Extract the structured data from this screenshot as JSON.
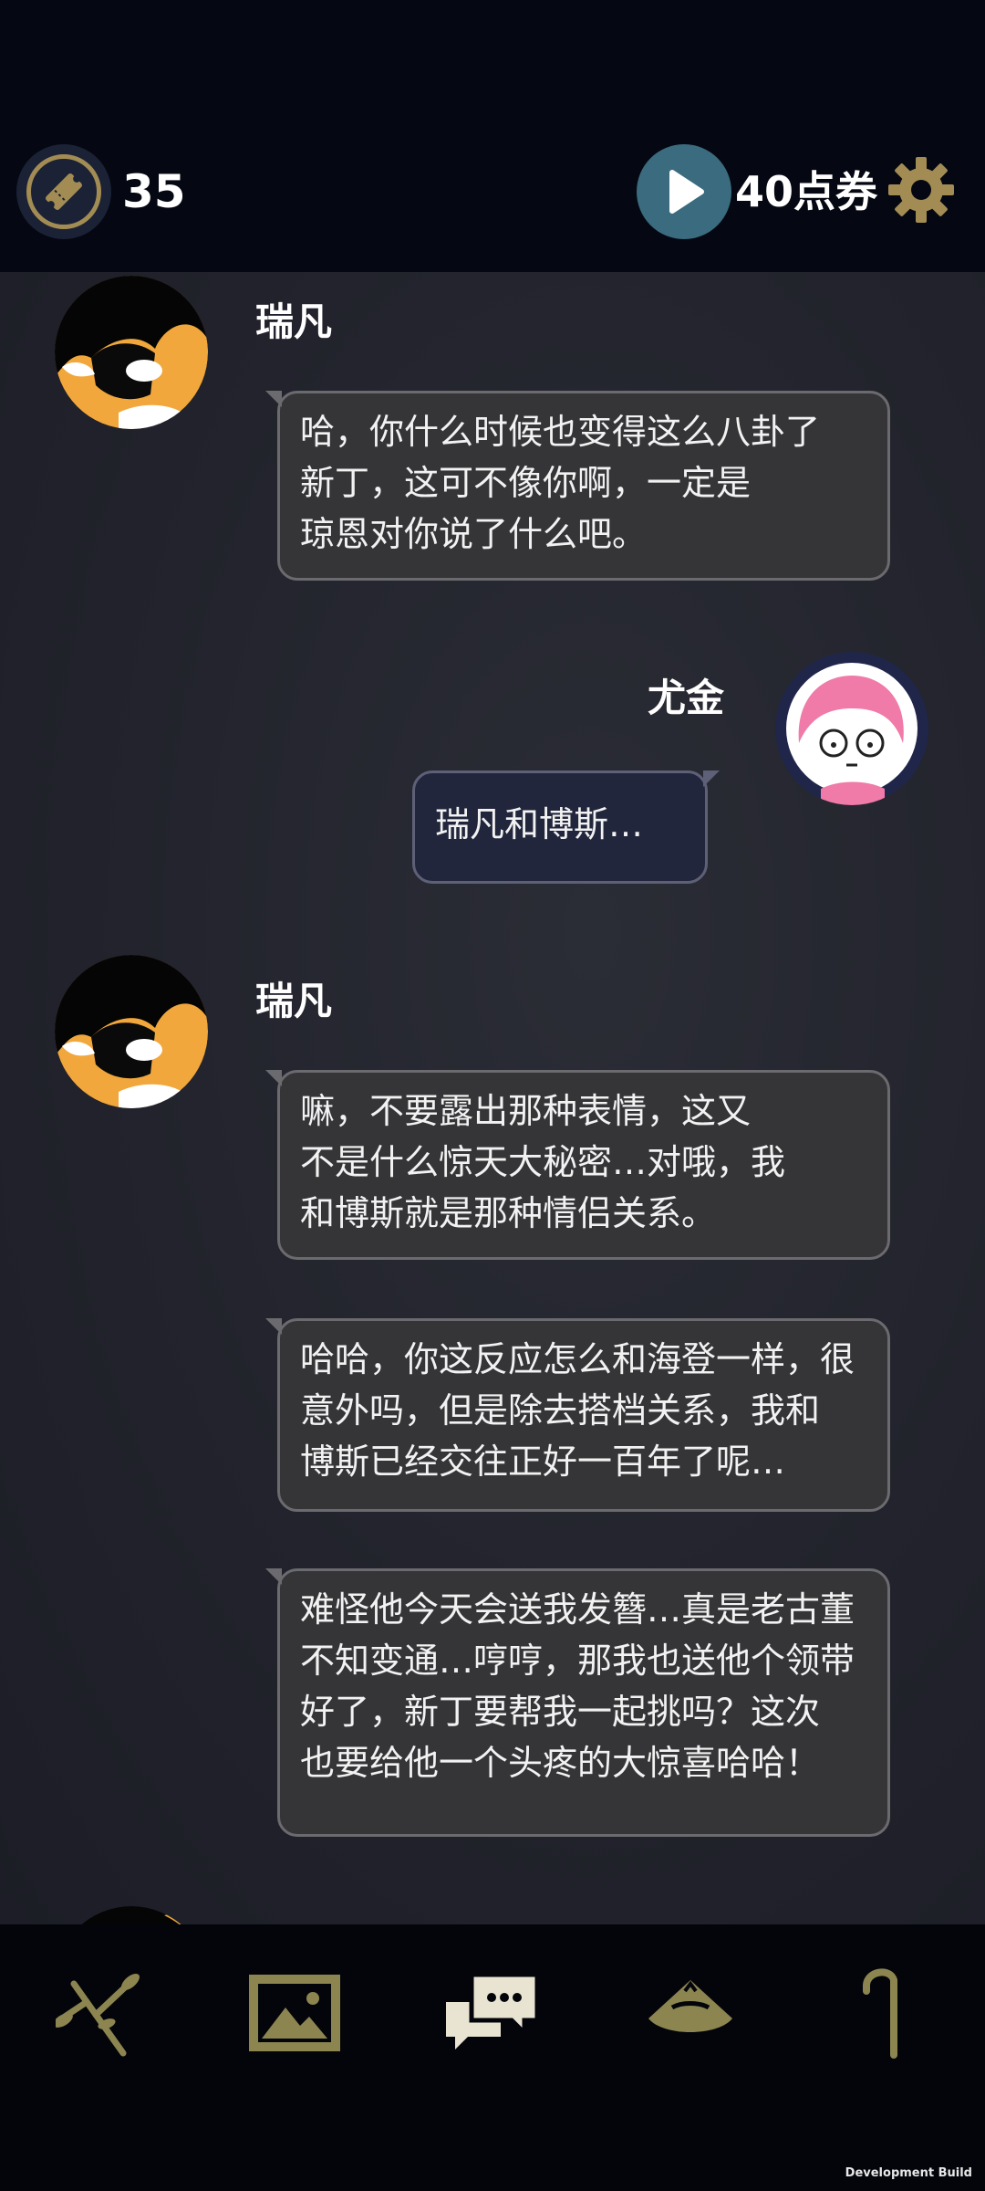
{
  "header": {
    "ticket_count": "35",
    "points_label": "40点券",
    "accent_color": "#a38c54",
    "play_color": "#3a6b7e"
  },
  "messages": [
    {
      "side": "left",
      "sender": "瑞凡",
      "lines": [
        "哈，你什么时候也变得这么八卦了",
        "新丁，这可不像你啊，一定是",
        "琼恩对你说了什么吧。"
      ]
    },
    {
      "side": "right",
      "sender": "尤金",
      "lines": [
        "瑞凡和博斯…"
      ]
    },
    {
      "side": "left",
      "sender": "瑞凡",
      "lines": [
        "嘛，不要露出那种表情，这又",
        "不是什么惊天大秘密…对哦，我",
        "和博斯就是那种情侣关系。"
      ]
    },
    {
      "side": "left",
      "sender": "",
      "lines": [
        "哈哈，你这反应怎么和海登一样，很",
        "意外吗，但是除去搭档关系，我和",
        "博斯已经交往正好一百年了呢…"
      ]
    },
    {
      "side": "left",
      "sender": "",
      "lines": [
        "难怪他今天会送我发簪…真是老古董",
        "不知变通…哼哼，那我也送他个领带",
        "好了，新丁要帮我一起挑吗？这次",
        "也要给他一个头疼的大惊喜哈哈！"
      ]
    }
  ],
  "nav": {
    "items": [
      "branch-icon",
      "gallery-icon",
      "chat-icon",
      "hat-icon",
      "cane-icon"
    ],
    "icon_color": "#8c8550"
  },
  "footer": {
    "build_label": "Development Build"
  }
}
